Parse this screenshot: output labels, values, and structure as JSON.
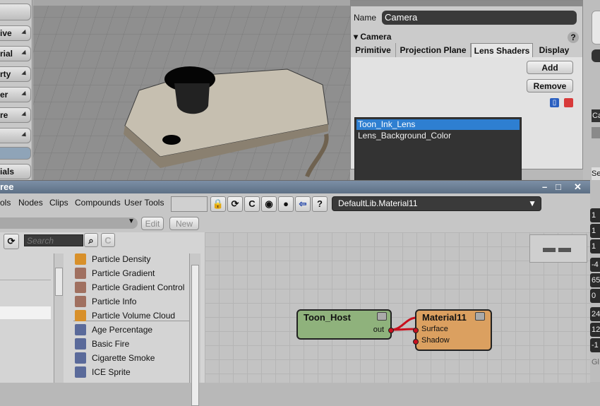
{
  "left_panel": {
    "items": [
      {
        "label": "ive"
      },
      {
        "label": "rial"
      },
      {
        "label": "rty"
      },
      {
        "label": "er"
      },
      {
        "label": "re"
      },
      {
        "label": ""
      },
      {
        "label": ""
      },
      {
        "label": "ials"
      }
    ]
  },
  "camera_ppg": {
    "name_label": "Name",
    "name_value": "Camera",
    "section_title": "Camera",
    "help": "?",
    "tabs": [
      "Primitive",
      "Projection Plane",
      "Lens Shaders",
      "Display"
    ],
    "active_tab": "Lens Shaders",
    "shaders": [
      "Toon_Ink_Lens",
      "Lens_Background_Color"
    ],
    "selected_shader": "Toon_Ink_Lens",
    "add_label": "Add",
    "remove_label": "Remove",
    "side_item": "Ca",
    "side_item2": "Se"
  },
  "render_tree": {
    "title": "ree",
    "menus": [
      "ols",
      "Nodes",
      "Clips",
      "Compounds",
      "User Tools"
    ],
    "material_path": "DefaultLib.Material11",
    "edit_label": "Edit",
    "new_label": "New",
    "search_placeholder": "Search",
    "palette_items": [
      {
        "label": "Particle Density",
        "icon": "flame-icon"
      },
      {
        "label": "Particle Gradient",
        "icon": "gradient-icon"
      },
      {
        "label": "Particle Gradient Control",
        "icon": "gradient-icon"
      },
      {
        "label": "Particle Info",
        "icon": "gradient-icon"
      },
      {
        "label": "Particle Volume Cloud",
        "icon": "flame-icon"
      },
      {
        "label": "Age Percentage",
        "icon": "cube-icon"
      },
      {
        "label": "Basic Fire",
        "icon": "cube-icon"
      },
      {
        "label": "Cigarette Smoke",
        "icon": "cube-icon"
      },
      {
        "label": "ICE Sprite",
        "icon": "cube-icon"
      }
    ],
    "nodes": {
      "toon_host": {
        "title": "Toon_Host",
        "out": "out"
      },
      "material": {
        "title": "Material11",
        "ports": [
          "Surface",
          "Shadow"
        ]
      }
    },
    "right_values": [
      "1",
      "1",
      "1",
      "-4",
      "65",
      "0",
      "24",
      "12",
      "-1",
      "Gl"
    ]
  },
  "colors": {
    "toon_host_node": "#8fb27c",
    "material_node": "#dba060",
    "connection": "#c8101e",
    "selection": "#2e7fd1"
  }
}
